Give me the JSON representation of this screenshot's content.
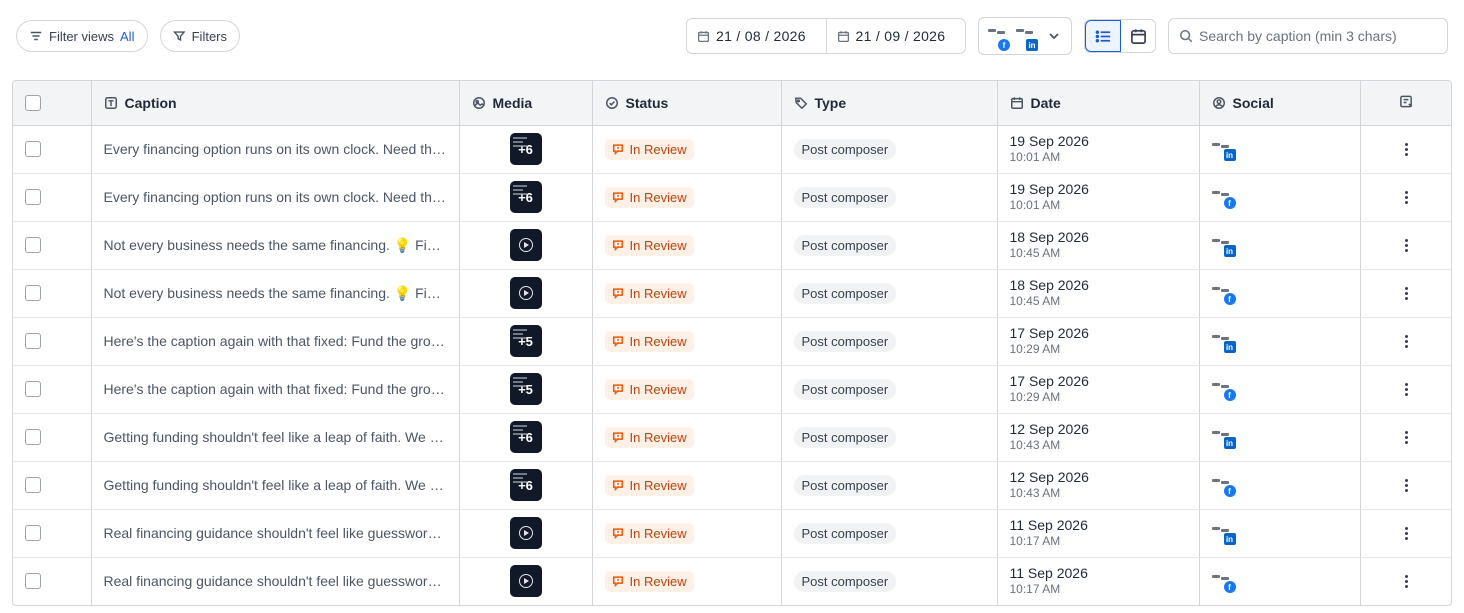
{
  "toolbar": {
    "filter_views_label": "Filter views",
    "filter_views_value": "All",
    "filters_label": "Filters",
    "date_from": "21 / 08 / 2026",
    "date_to": "21 / 09 / 2026",
    "search_placeholder": "Search by caption (min 3 chars)",
    "search_value": "",
    "accent_color": "#1d5bd6"
  },
  "table": {
    "columns": {
      "caption": "Caption",
      "media": "Media",
      "status": "Status",
      "type": "Type",
      "date": "Date",
      "social": "Social"
    },
    "rows": [
      {
        "caption": "Every financing option runs on its own clock. Need the right fit? Let us help you find it.",
        "media": "+6",
        "media_kind": "carousel",
        "status": "In Review",
        "type": "Post composer",
        "date": "19 Sep 2026",
        "time": "10:01 AM",
        "network": "in"
      },
      {
        "caption": "Every financing option runs on its own clock. Need the right fit? Let us help you find it.",
        "media": "+6",
        "media_kind": "carousel",
        "status": "In Review",
        "type": "Post composer",
        "date": "19 Sep 2026",
        "time": "10:01 AM",
        "network": "f"
      },
      {
        "caption": "Not every business needs the same financing. 💡 Find the right fit for yours.",
        "media": "",
        "media_kind": "video",
        "status": "In Review",
        "type": "Post composer",
        "date": "18 Sep 2026",
        "time": "10:45 AM",
        "network": "in"
      },
      {
        "caption": "Not every business needs the same financing. 💡 Find the right fit for yours.",
        "media": "",
        "media_kind": "video",
        "status": "In Review",
        "type": "Post composer",
        "date": "18 Sep 2026",
        "time": "10:45 AM",
        "network": "f"
      },
      {
        "caption": "Here's the caption again with that fixed: Fund the growth you've been planning.",
        "media": "+5",
        "media_kind": "carousel",
        "status": "In Review",
        "type": "Post composer",
        "date": "17 Sep 2026",
        "time": "10:29 AM",
        "network": "in"
      },
      {
        "caption": "Here's the caption again with that fixed: Fund the growth you've been planning.",
        "media": "+5",
        "media_kind": "carousel",
        "status": "In Review",
        "type": "Post composer",
        "date": "17 Sep 2026",
        "time": "10:29 AM",
        "network": "f"
      },
      {
        "caption": "Getting funding shouldn't feel like a leap of faith. We make it clear and simple.",
        "media": "+6",
        "media_kind": "carousel",
        "status": "In Review",
        "type": "Post composer",
        "date": "12 Sep 2026",
        "time": "10:43 AM",
        "network": "in"
      },
      {
        "caption": "Getting funding shouldn't feel like a leap of faith. We make it clear and simple.",
        "media": "+6",
        "media_kind": "carousel",
        "status": "In Review",
        "type": "Post composer",
        "date": "12 Sep 2026",
        "time": "10:43 AM",
        "network": "f"
      },
      {
        "caption": "Real financing guidance shouldn't feel like guesswork. Talk to our team today.",
        "media": "",
        "media_kind": "video",
        "status": "In Review",
        "type": "Post composer",
        "date": "11 Sep 2026",
        "time": "10:17 AM",
        "network": "in"
      },
      {
        "caption": "Real financing guidance shouldn't feel like guesswork. Talk to our team today.",
        "media": "",
        "media_kind": "video",
        "status": "In Review",
        "type": "Post composer",
        "date": "11 Sep 2026",
        "time": "10:17 AM",
        "network": "f"
      }
    ]
  }
}
